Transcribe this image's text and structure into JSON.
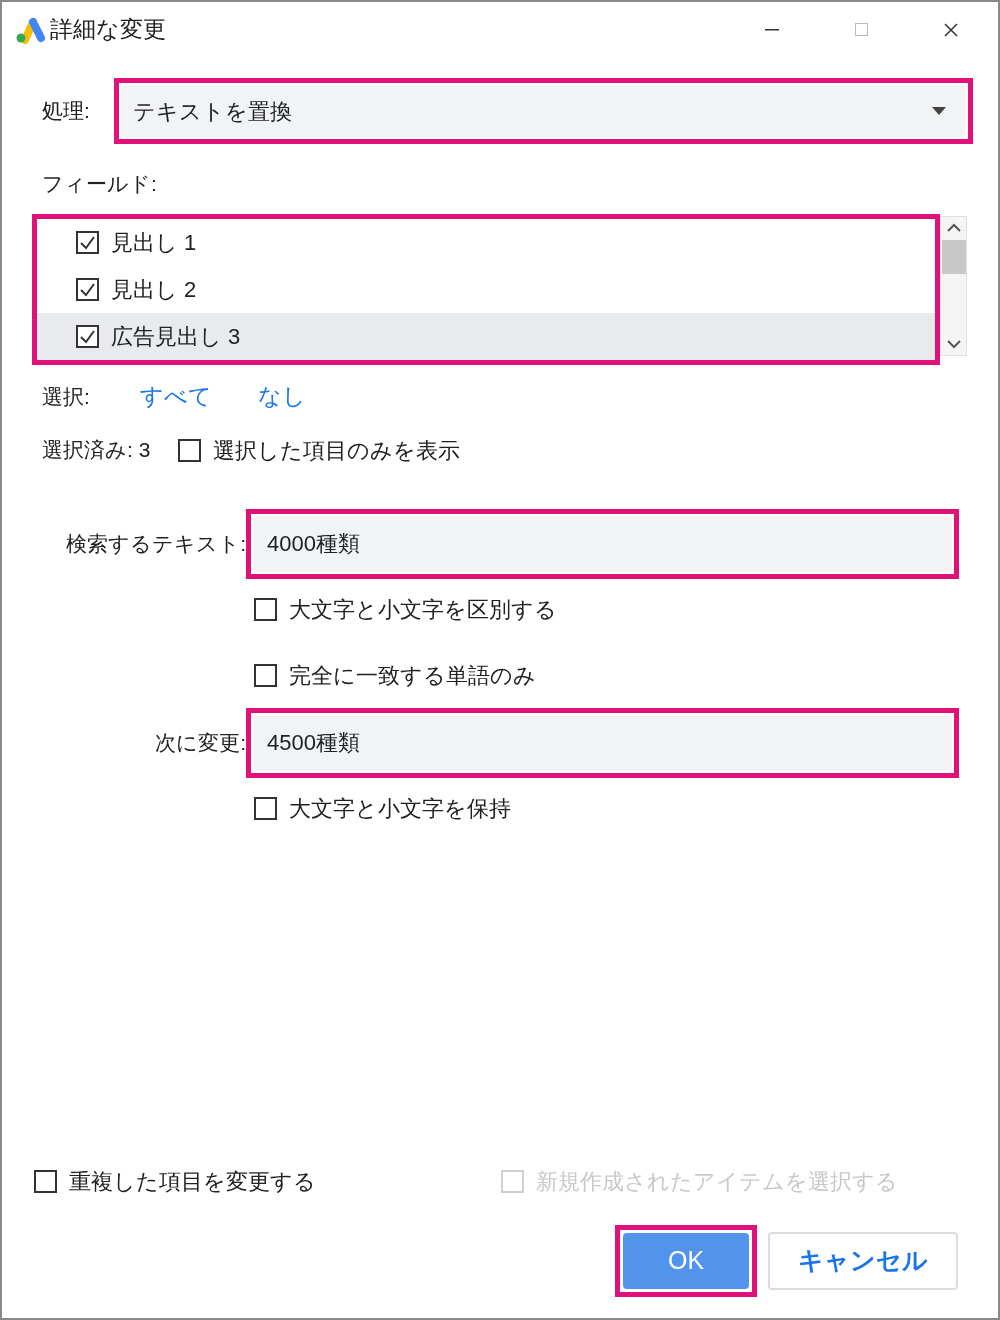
{
  "window": {
    "title": "詳細な変更"
  },
  "action": {
    "label": "処理:",
    "value": "テキストを置換",
    "highlighted": true
  },
  "fields": {
    "label": "フィールド:",
    "highlighted": true,
    "items": [
      {
        "label": "見出し 1",
        "checked": true,
        "selected": false
      },
      {
        "label": "見出し 2",
        "checked": true,
        "selected": false
      },
      {
        "label": "広告見出し 3",
        "checked": true,
        "selected": true
      }
    ]
  },
  "select": {
    "label": "選択:",
    "links": [
      "すべて",
      "なし"
    ]
  },
  "selected_count": "選択済み: 3",
  "show_selected_only": {
    "label": "選択した項目のみを表示",
    "checked": false
  },
  "find": {
    "label": "検索するテキスト:",
    "value": "4000種類",
    "highlighted": true,
    "options": [
      {
        "label": "大文字と小文字を区別する",
        "checked": false
      },
      {
        "label": "完全に一致する単語のみ",
        "checked": false
      }
    ]
  },
  "replace": {
    "label": "次に変更:",
    "value": "4500種類",
    "highlighted": true,
    "options": [
      {
        "label": "大文字と小文字を保持",
        "checked": false
      }
    ]
  },
  "footer_options": [
    {
      "label": "重複した項目を変更する",
      "checked": false,
      "disabled": false
    },
    {
      "label": "新規作成されたアイテムを選択する",
      "checked": false,
      "disabled": true
    }
  ],
  "buttons": [
    {
      "label": "OK",
      "kind": "primary",
      "highlighted": true
    },
    {
      "label": "キャンセル",
      "kind": "secondary",
      "highlighted": false
    }
  ]
}
